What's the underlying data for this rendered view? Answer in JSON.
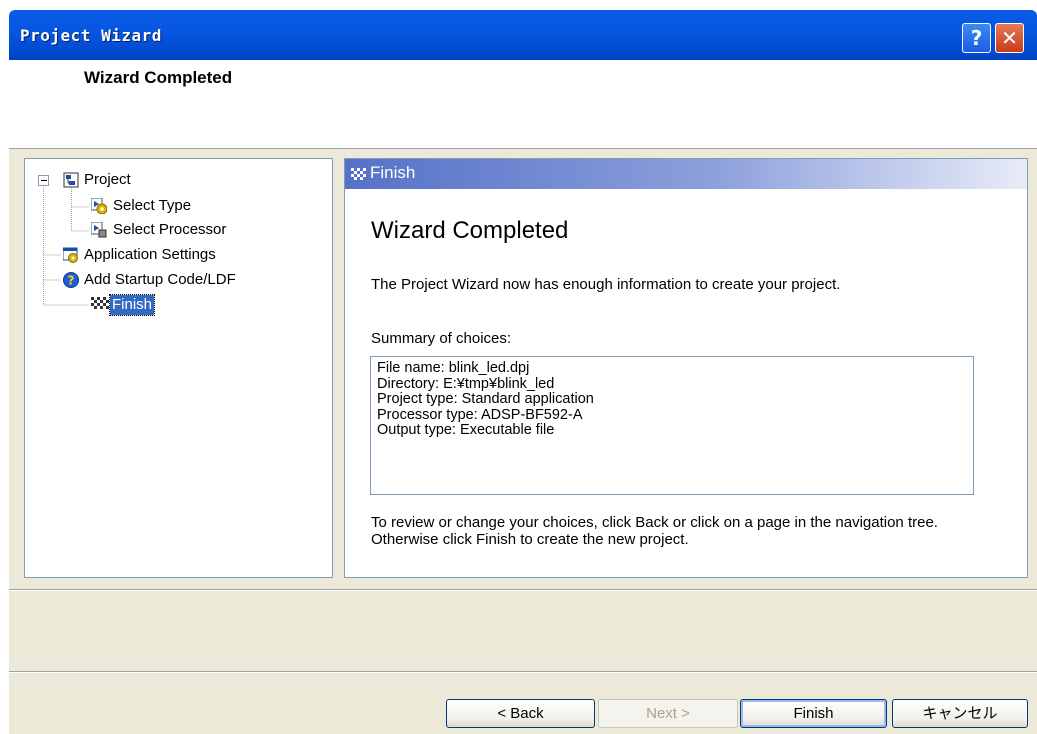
{
  "window": {
    "title": "Project Wizard",
    "help_glyph": "?",
    "close_glyph": "✕"
  },
  "header": {
    "title": "Wizard Completed"
  },
  "nav_tree": {
    "items": [
      {
        "label": "Project",
        "icon": "project-icon"
      },
      {
        "label": "Select Type",
        "icon": "select-type-icon"
      },
      {
        "label": "Select Processor",
        "icon": "select-processor-icon"
      },
      {
        "label": "Application Settings",
        "icon": "application-settings-icon"
      },
      {
        "label": "Add Startup Code/LDF",
        "icon": "help-question-icon"
      },
      {
        "label": "Finish",
        "icon": "checkered-flag-icon",
        "selected": true
      }
    ]
  },
  "panel": {
    "header": "Finish",
    "heading": "Wizard Completed",
    "intro": "The Project Wizard now has enough information to create your project.",
    "summary_label": "Summary of choices:",
    "summary_lines": [
      "File name: blink_led.dpj",
      "Directory: E:¥tmp¥blink_led",
      "Project type: Standard application",
      "Processor type: ADSP-BF592-A",
      "Output type: Executable file"
    ],
    "review": "To review or change your choices, click Back or click on a page in the navigation tree.  Otherwise click Finish to create the new project."
  },
  "buttons": {
    "back": "< Back",
    "next": "Next >",
    "finish": "Finish",
    "cancel": "キャンセル"
  },
  "colors": {
    "titlebar": "#0256e0",
    "panel_header": "#6b84d2",
    "dialog_bg": "#ece9d8",
    "selection": "#316ac5"
  }
}
